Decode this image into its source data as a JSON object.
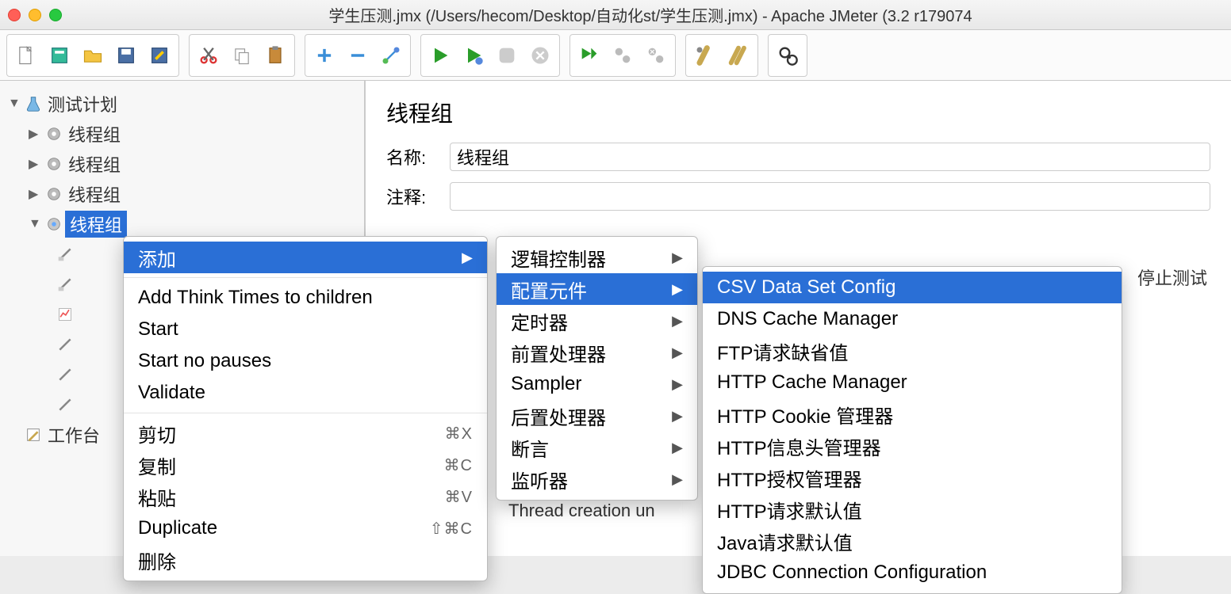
{
  "window": {
    "title": "学生压测.jmx (/Users/hecom/Desktop/自动化st/学生压测.jmx) - Apache JMeter (3.2 r179074"
  },
  "tree": {
    "root": "测试计划",
    "tg1": "线程组",
    "tg2": "线程组",
    "tg3": "线程组",
    "tg4": "线程组",
    "wb": "工作台"
  },
  "panel": {
    "heading": "线程组",
    "name_label": "名称:",
    "name_value": "线程组",
    "comment_label": "注释:",
    "stop_label": "停止测试",
    "thread_creation": "Thread creation un"
  },
  "menu1": {
    "add": "添加",
    "think": "Add Think Times to children",
    "start": "Start",
    "start_np": "Start no pauses",
    "validate": "Validate",
    "cut": "剪切",
    "copy": "复制",
    "paste": "粘贴",
    "duplicate": "Duplicate",
    "delete": "删除",
    "sc_cut": "⌘X",
    "sc_copy": "⌘C",
    "sc_paste": "⌘V",
    "sc_dup": "⇧⌘C"
  },
  "menu2": {
    "logic": "逻辑控制器",
    "config": "配置元件",
    "timer": "定时器",
    "pre": "前置处理器",
    "sampler": "Sampler",
    "post": "后置处理器",
    "assert": "断言",
    "listener": "监听器"
  },
  "menu3": {
    "csv": "CSV Data Set Config",
    "dns": "DNS Cache Manager",
    "ftp": "FTP请求缺省值",
    "httpcache": "HTTP Cache Manager",
    "httpcookie": "HTTP Cookie 管理器",
    "httpheader": "HTTP信息头管理器",
    "httpauth": "HTTP授权管理器",
    "httpdef": "HTTP请求默认值",
    "javadef": "Java请求默认值",
    "jdbc": "JDBC Connection Configuration"
  }
}
